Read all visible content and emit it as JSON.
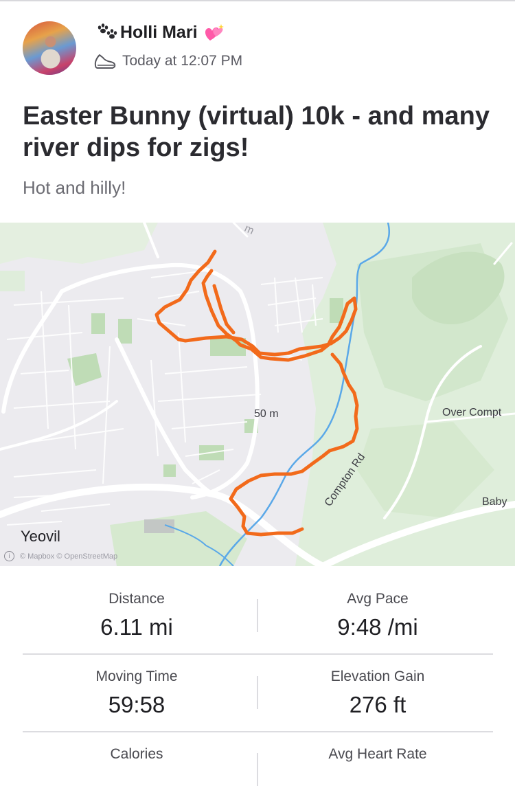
{
  "post": {
    "author": "Holli Mari",
    "timestamp": "Today at 12:07 PM",
    "title": "Easter Bunny (virtual) 10k - and many river dips for zigs!",
    "description": "Hot and hilly!"
  },
  "map": {
    "labels": {
      "town": "Yeovil",
      "contour_50": "50 m",
      "contour_top": "m",
      "over_compton": "Over Compt",
      "compton_rd": "Compton Rd",
      "baby": "Baby"
    },
    "attribution": "© Mapbox © OpenStreetMap",
    "route_color": "#f26a1b",
    "river_color": "#5aa8e8"
  },
  "stats": {
    "distance": {
      "label": "Distance",
      "value": "6.11 mi"
    },
    "avg_pace": {
      "label": "Avg Pace",
      "value": "9:48 /mi"
    },
    "moving_time": {
      "label": "Moving Time",
      "value": "59:58"
    },
    "elevation_gain": {
      "label": "Elevation Gain",
      "value": "276 ft"
    },
    "calories": {
      "label": "Calories"
    },
    "avg_heart_rate": {
      "label": "Avg Heart Rate"
    }
  },
  "colors": {
    "text_primary": "#242428",
    "text_secondary": "#6b6b72",
    "heart": "#ff5aa8",
    "park_green": "#cfe6c6"
  }
}
